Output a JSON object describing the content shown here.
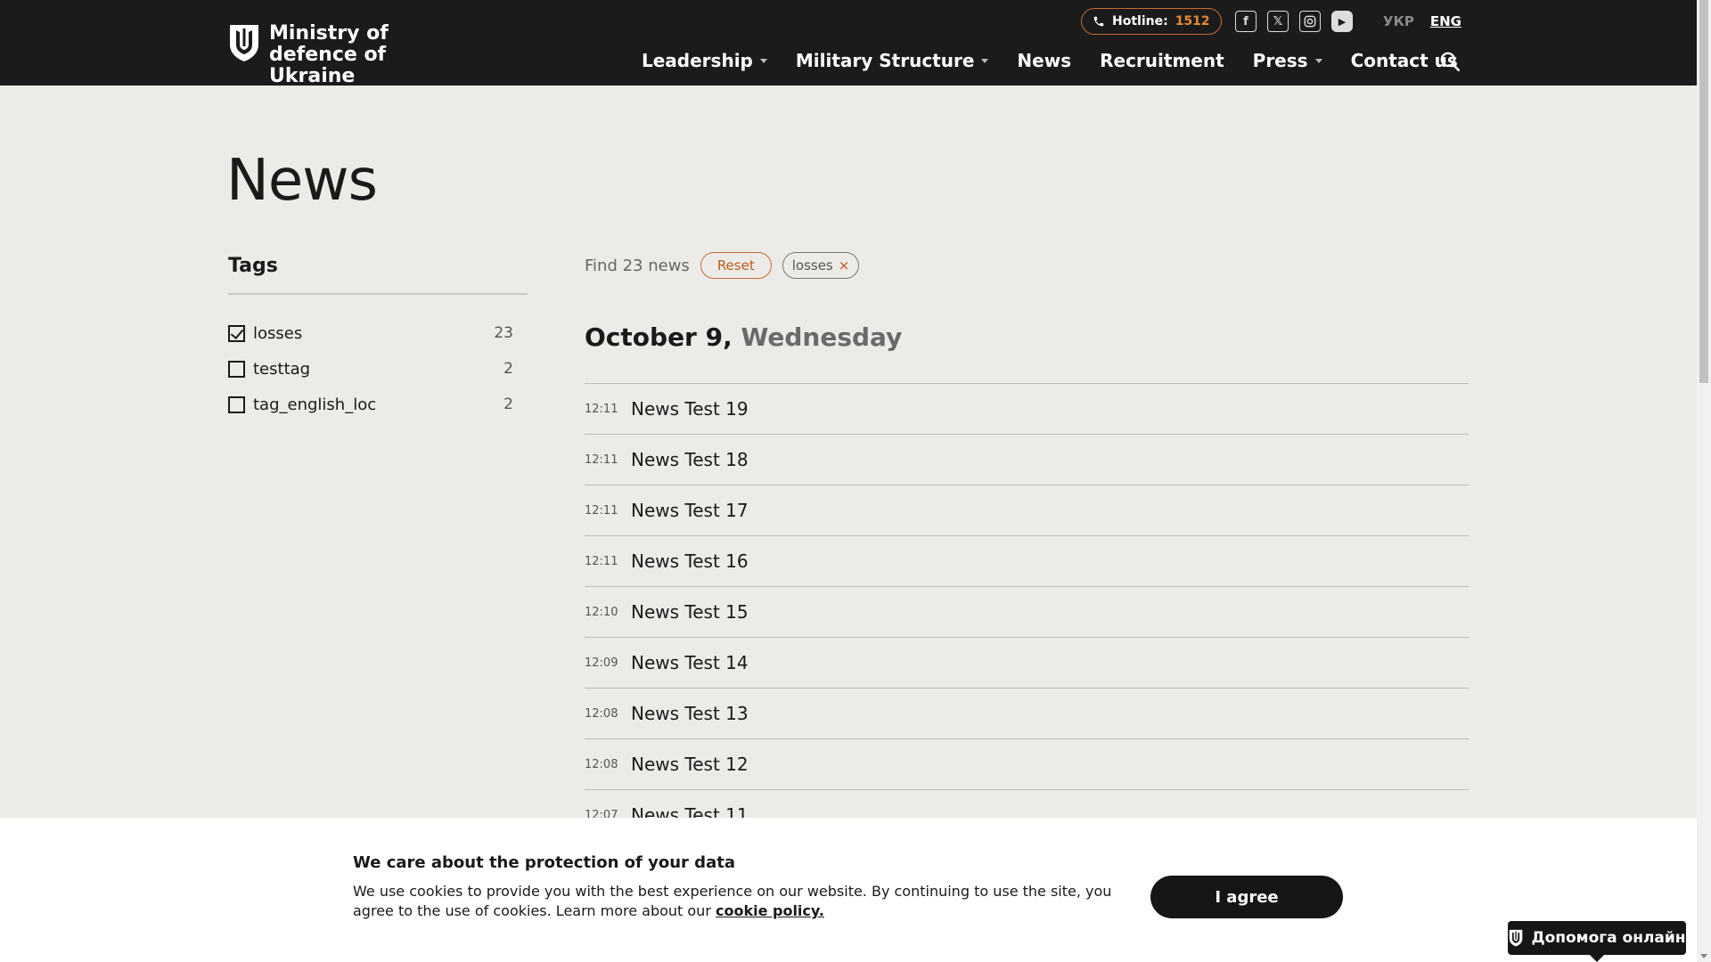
{
  "header": {
    "logo_text": "Ministry of defence of Ukraine",
    "hotline_label": "Hotline:",
    "hotline_number": "1512",
    "socials": [
      "facebook-icon",
      "x-twitter-icon",
      "instagram-icon",
      "youtube-icon"
    ],
    "lang_ukr": "УКР",
    "lang_eng": "ENG",
    "nav": [
      {
        "label": "Leadership",
        "dropdown": true
      },
      {
        "label": "Military Structure",
        "dropdown": true
      },
      {
        "label": "News",
        "dropdown": false
      },
      {
        "label": "Recruitment",
        "dropdown": false
      },
      {
        "label": "Press",
        "dropdown": true
      },
      {
        "label": "Contact us",
        "dropdown": false
      }
    ]
  },
  "page": {
    "title": "News"
  },
  "tags": {
    "title": "Tags",
    "items": [
      {
        "label": "losses",
        "count": "23",
        "checked": true
      },
      {
        "label": "testtag",
        "count": "2",
        "checked": false
      },
      {
        "label": "tag_english_loc",
        "count": "2",
        "checked": false
      }
    ]
  },
  "filter": {
    "found_text": "Find 23 news",
    "reset_label": "Reset",
    "active_chip": "losses",
    "chip_remove": "×"
  },
  "date_heading": {
    "date": "October 9,",
    "weekday": "Wednesday"
  },
  "news": [
    {
      "time": "12:11",
      "title": "News Test 19"
    },
    {
      "time": "12:11",
      "title": "News Test 18"
    },
    {
      "time": "12:11",
      "title": "News Test 17"
    },
    {
      "time": "12:11",
      "title": "News Test 16"
    },
    {
      "time": "12:10",
      "title": "News Test 15"
    },
    {
      "time": "12:09",
      "title": "News Test 14"
    },
    {
      "time": "12:08",
      "title": "News Test 13"
    },
    {
      "time": "12:08",
      "title": "News Test 12"
    },
    {
      "time": "12:07",
      "title": "News Test 11"
    }
  ],
  "cookie": {
    "title": "We care about the protection of your data",
    "text": "We use cookies to provide you with the best experience on our website. By continuing to use the site, you agree to the use of cookies. Learn more about our ",
    "link": "cookie policy.",
    "agree": "I agree"
  },
  "help": {
    "label": "Допомога онлайн"
  },
  "colors": {
    "header_bg": "#1b1b1b",
    "page_bg": "#ecebe7",
    "accent": "#c96b2c"
  }
}
